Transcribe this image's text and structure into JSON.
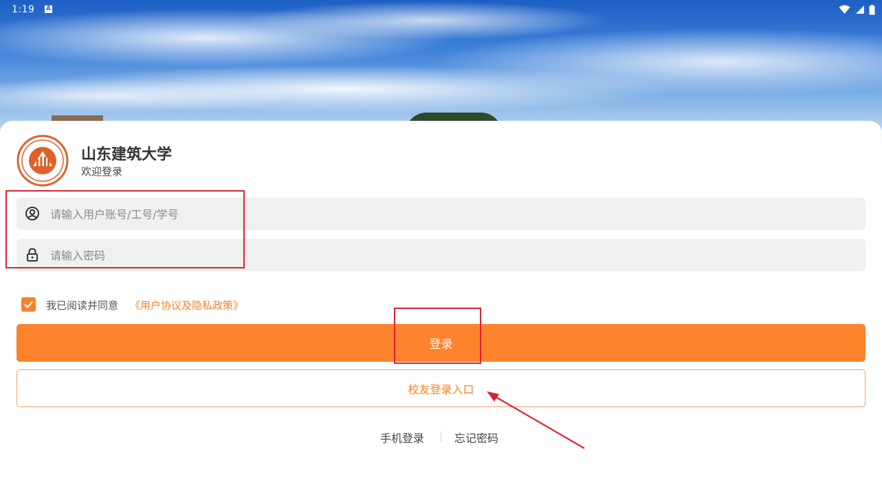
{
  "status_bar": {
    "time": "1:19",
    "notification_glyph": "A",
    "icons": [
      "wifi-icon",
      "cellular-signal-icon",
      "battery-icon"
    ]
  },
  "header": {
    "logo_name": "university-seal-logo",
    "school_name": "山东建筑大学",
    "welcome": "欢迎登录"
  },
  "form": {
    "username_placeholder": "请输入用户账号/工号/学号",
    "password_placeholder": "请输入密码",
    "agreement_checked": true,
    "agreement_text": "我已阅读并同意",
    "agreement_link": "《用户协议及隐私政策》",
    "login_button": "登录",
    "alumni_button": "校友登录入口"
  },
  "footer_links": {
    "phone_login": "手机登录",
    "forgot_password": "忘记密码"
  },
  "colors": {
    "accent": "#fc822b",
    "annotation": "#d9232e",
    "input_bg": "#f0f0f0"
  }
}
